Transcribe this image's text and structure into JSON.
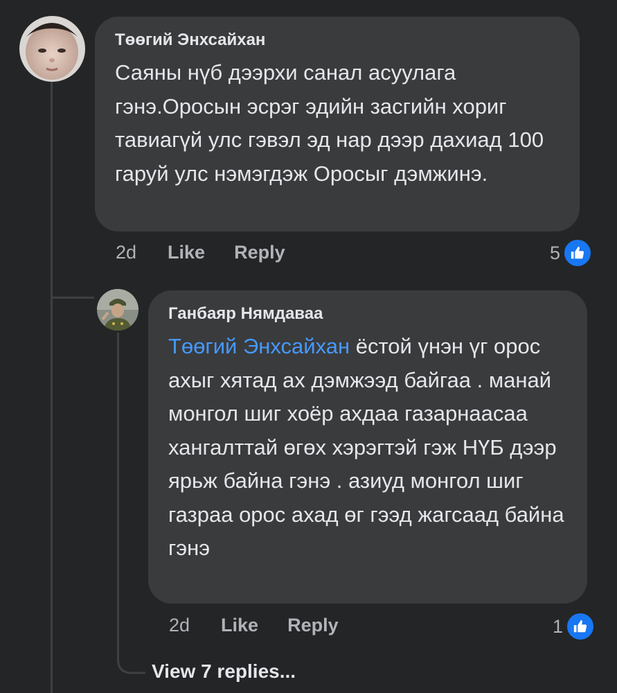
{
  "comment1": {
    "author": "Төөгий Энхсайхан",
    "text": "Саяны нүб дээрхи санал асуулага гэнэ.Оросын эсрэг эдийн засгийн хориг тавиагүй улс гэвэл эд нар дээр дахиад 100 гаруй улс нэмэгдэж Оросыг дэмжинэ.",
    "time": "2d",
    "like_label": "Like",
    "reply_label": "Reply",
    "reaction_count": "5"
  },
  "reply1": {
    "author": "Ганбаяр Нямдаваа",
    "mention": "Төөгий Энхсайхан",
    "text": " ёстой үнэн үг орос ахыг хятад ах дэмжээд байгаа . манай монгол шиг хоёр ахдаа газарнаасаа хангалттай өгөх хэрэгтэй гэж НҮБ дээр ярьж байна гэнэ . азиуд монгол шиг газраа орос ахад өг гээд жагсаад байна гэнэ",
    "time": "2d",
    "like_label": "Like",
    "reply_label": "Reply",
    "reaction_count": "1"
  },
  "view_replies_label": "View 7 replies...",
  "colors": {
    "like_blue": "#1877f2",
    "mention_blue": "#4599ff",
    "bubble": "#3a3b3c",
    "background": "#242526"
  },
  "icons": [
    "like-reaction-icon",
    "reply-arrow-icon"
  ]
}
